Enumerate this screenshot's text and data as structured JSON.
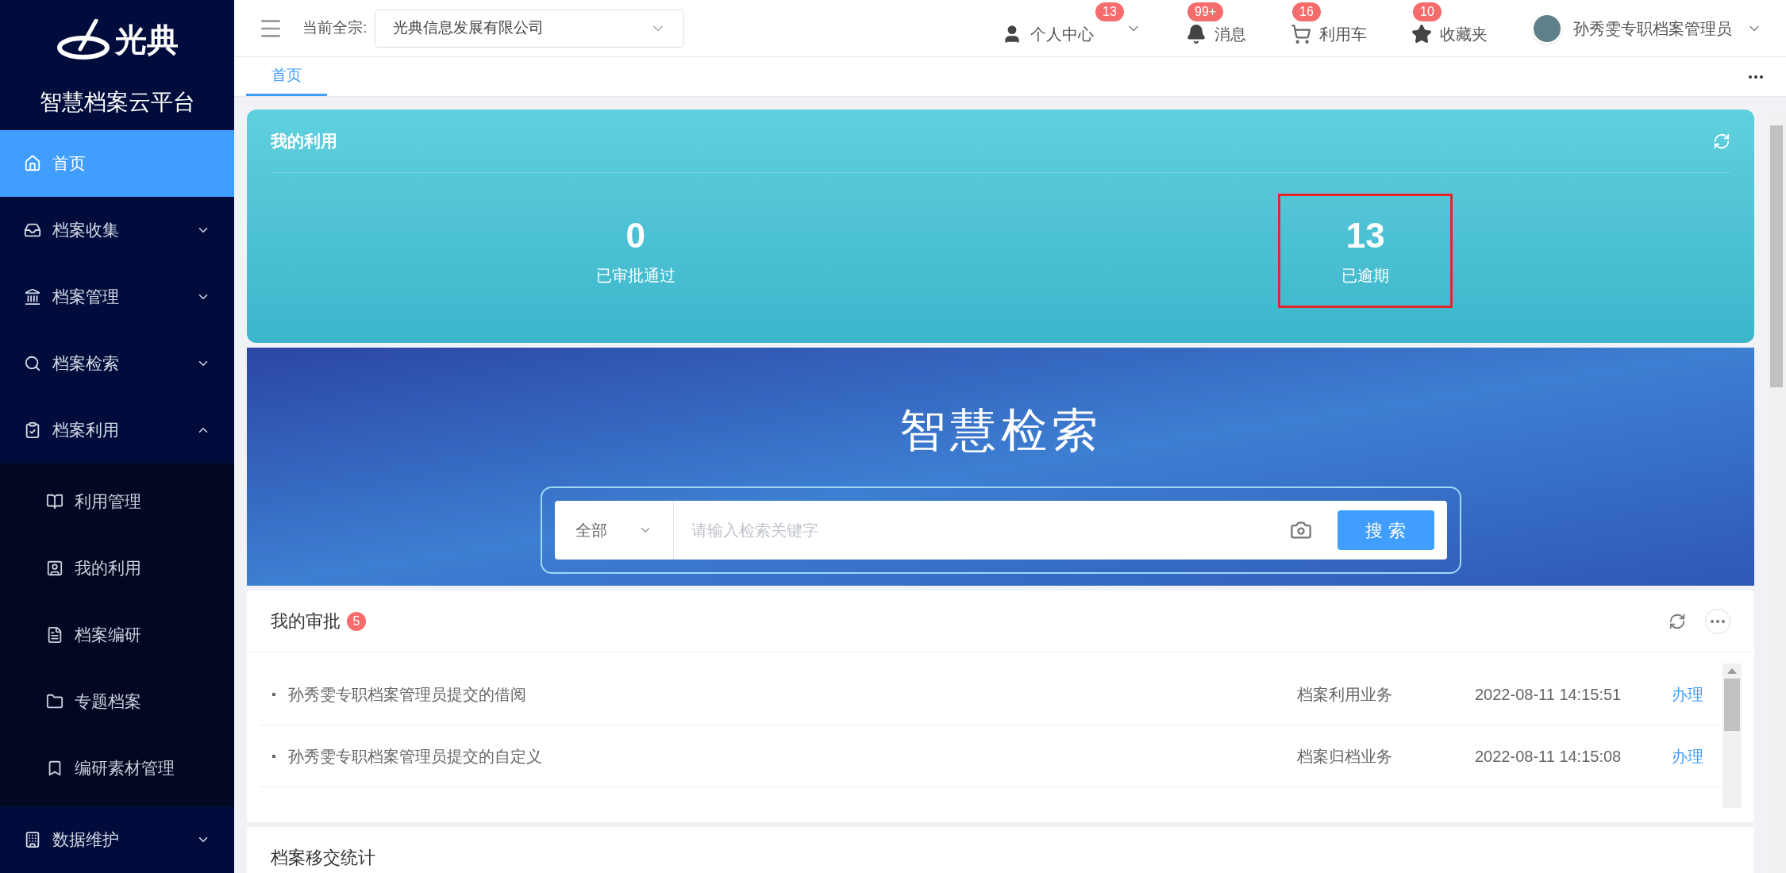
{
  "brand": {
    "logo_text": "光典",
    "platform": "智慧档案云平台"
  },
  "sidebar": {
    "items": [
      {
        "label": "首页",
        "selected": true
      },
      {
        "label": "档案收集",
        "selected": false,
        "expanded": false
      },
      {
        "label": "档案管理",
        "selected": false,
        "expanded": false
      },
      {
        "label": "档案检索",
        "selected": false,
        "expanded": false
      },
      {
        "label": "档案利用",
        "selected": false,
        "expanded": true,
        "children": [
          {
            "label": "利用管理",
            "selected": false
          },
          {
            "label": "我的利用",
            "selected": false
          },
          {
            "label": "档案编研",
            "selected": false
          },
          {
            "label": "专题档案",
            "selected": false
          },
          {
            "label": "编研素材管理",
            "selected": false
          }
        ]
      },
      {
        "label": "数据维护",
        "selected": false,
        "expanded": false
      }
    ]
  },
  "topbar": {
    "fonds_label": "当前全宗:",
    "fonds_value": "光典信息发展有限公司",
    "items": [
      {
        "label": "个人中心",
        "badge": "13"
      },
      {
        "label": "消息",
        "badge": "99+"
      },
      {
        "label": "利用车",
        "badge": "16"
      },
      {
        "label": "收藏夹",
        "badge": "10"
      }
    ],
    "user_name": "孙秀雯专职档案管理员"
  },
  "tabs": [
    {
      "label": "首页",
      "selected": true
    }
  ],
  "my_use": {
    "title": "我的利用",
    "stats": [
      {
        "value": "0",
        "label": "已审批通过",
        "highlighted": false
      },
      {
        "value": "13",
        "label": "已逾期",
        "highlighted": true
      }
    ]
  },
  "search_banner": {
    "title": "智慧检索",
    "scope": "全部",
    "placeholder": "请输入检索关键字",
    "button": "搜 索"
  },
  "approvals": {
    "title": "我的审批",
    "badge": "5",
    "rows": [
      {
        "title": "孙秀雯专职档案管理员提交的借阅",
        "type": "档案利用业务",
        "time": "2022-08-11 14:15:51",
        "action": "办理"
      },
      {
        "title": "孙秀雯专职档案管理员提交的自定义",
        "type": "档案归档业务",
        "time": "2022-08-11 14:15:08",
        "action": "办理"
      }
    ]
  },
  "transfer_stats": {
    "title": "档案移交统计"
  }
}
